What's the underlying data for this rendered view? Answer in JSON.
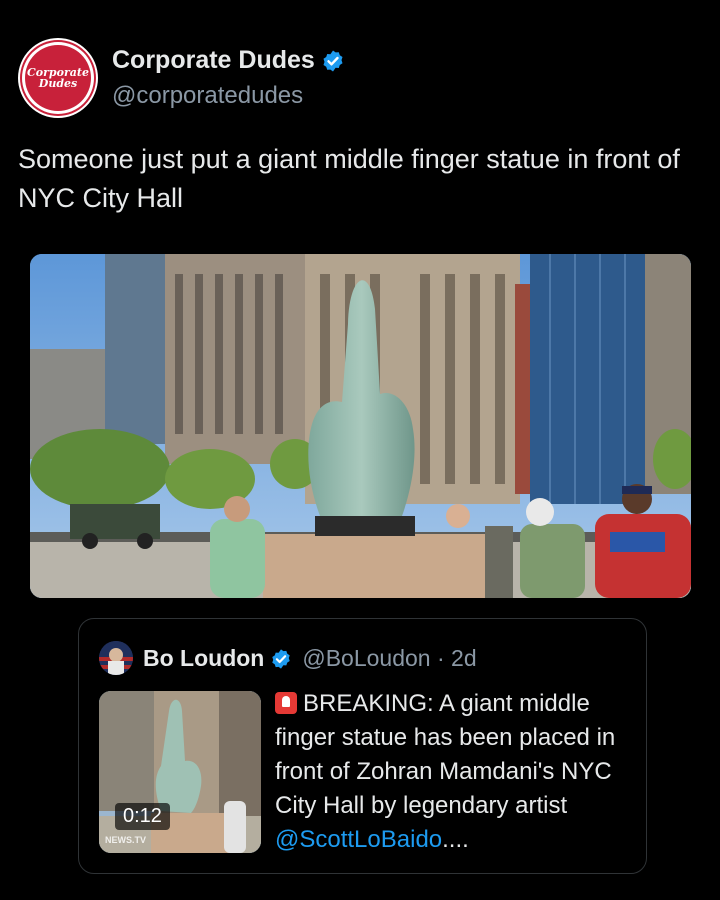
{
  "tweet": {
    "avatar_text_line1": "Corporate",
    "avatar_text_line2": "Dudes",
    "display_name": "Corporate Dudes",
    "handle": "@corporatedudes",
    "text": "Someone just put a giant middle finger statue in front of NYC City Hall",
    "verified": true
  },
  "quoted": {
    "display_name": "Bo Loudon",
    "handle_time": "@BoLoudon · 2d",
    "verified": true,
    "video_duration": "0:12",
    "thumb_watermark": "NEWS.TV",
    "text_before_link": "BREAKING: A giant middle finger statue has been placed in front of Zohran Mamdani's NYC City Hall by legendary artist ",
    "link_text": "@ScottLoBaido",
    "text_after_link": "....",
    "emoji_icon": "rotating-light-icon"
  },
  "colors": {
    "background": "#000000",
    "text_primary": "#e7e9ea",
    "text_secondary": "#8b98a5",
    "link": "#1d9bf0",
    "verified_badge": "#1d9bf0",
    "avatar_red": "#c8213a"
  }
}
